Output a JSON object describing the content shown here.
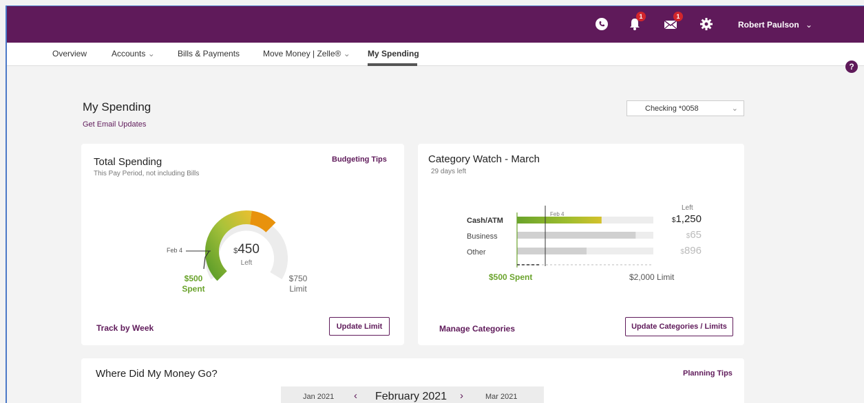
{
  "topbar": {
    "user_name": "Robert Paulson",
    "notification_count": "1",
    "message_count": "1"
  },
  "nav": {
    "overview": "Overview",
    "accounts": "Accounts",
    "bills": "Bills & Payments",
    "move_money": "Move Money | Zelle®",
    "my_spending": "My Spending"
  },
  "help_label": "?",
  "header": {
    "title": "My Spending",
    "email_link": "Get Email Updates",
    "account_select": "Checking *0058"
  },
  "total_spending": {
    "title": "Total Spending",
    "subtitle": "This Pay Period, not including Bills",
    "tips_link": "Budgeting Tips",
    "left_currency": "$",
    "left_amount": "450",
    "left_label": "Left",
    "marker_label": "Feb 4",
    "spent_amount": "$500",
    "spent_label": "Spent",
    "limit_amount": "$750",
    "limit_label": "Limit",
    "spent_fraction": 0.667,
    "track_link": "Track by Week",
    "update_button": "Update Limit"
  },
  "category_watch": {
    "title": "Category Watch - March",
    "subtitle": "29 days left",
    "left_header": "Left",
    "marker_label": "Feb 4",
    "rows": [
      {
        "label": "Cash/ATM",
        "currency": "$",
        "amount": "1,250",
        "fill": 0.62
      },
      {
        "label": "Business",
        "currency": "$",
        "amount": "65",
        "fill": 0.87
      },
      {
        "label": "Other",
        "currency": "$",
        "amount": "896",
        "fill": 0.51
      }
    ],
    "spent_label": "$500 Spent",
    "limit_label": "$2,000 Limit",
    "manage_link": "Manage Categories",
    "update_button": "Update Categories / Limits"
  },
  "where_money": {
    "title": "Where Did My Money Go?",
    "tips_link": "Planning Tips",
    "prev_month": "Jan 2021",
    "current_month": "February 2021",
    "next_month": "Mar 2021"
  },
  "colors": {
    "brand": "#5f1a5a",
    "green": "#6aa32c",
    "orange": "#e8920c"
  }
}
